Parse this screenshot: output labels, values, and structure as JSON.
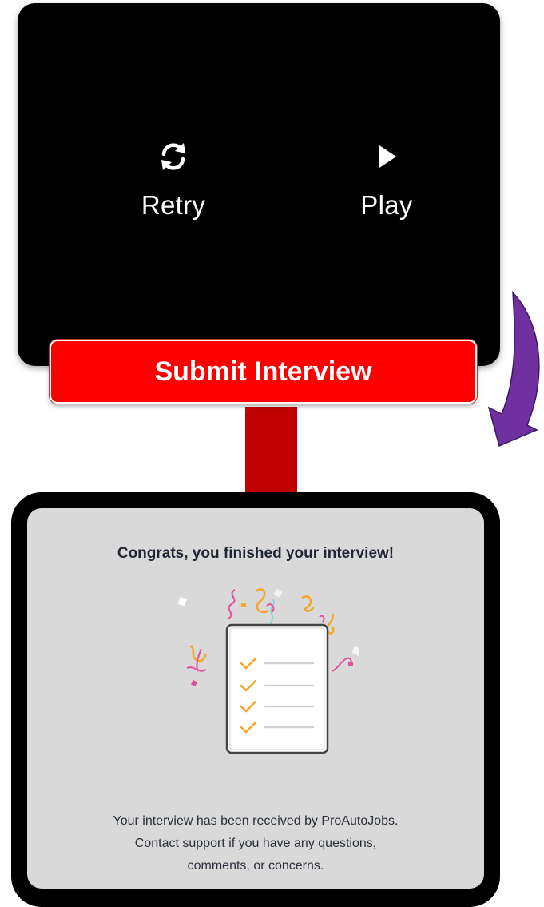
{
  "player": {
    "retry_label": "Retry",
    "play_label": "Play",
    "retry_icon": "refresh-icon",
    "play_icon": "play-icon"
  },
  "submit": {
    "label": "Submit Interview"
  },
  "colors": {
    "submit": "#ff0000",
    "connector": "#c00000",
    "arrow": "#7030a0",
    "checkmark": "#f5a623"
  },
  "completion": {
    "title": "Congrats, you finished your interview!",
    "message": "Your interview has been received by ProAutoJobs. Contact support if you have any questions, comments, or concerns.",
    "checklist_items": 4
  }
}
